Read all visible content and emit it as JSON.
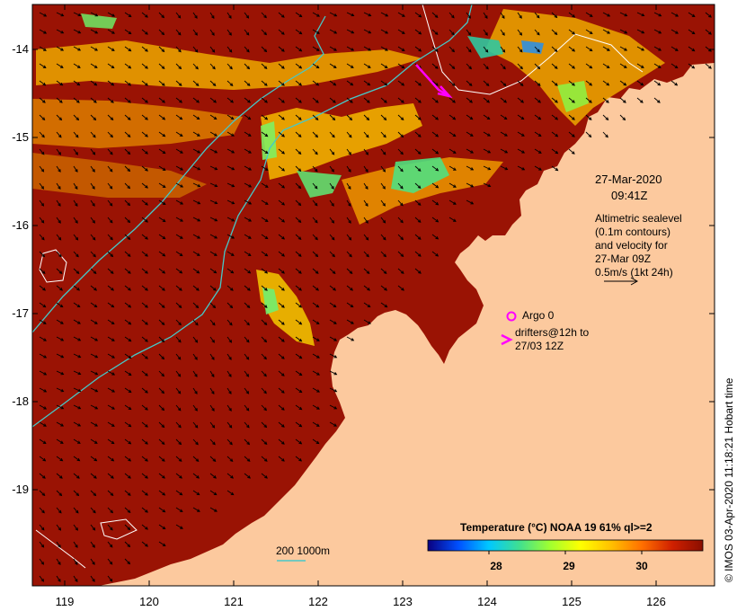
{
  "lat_axis": {
    "labels": [
      "-14",
      "-15",
      "-16",
      "-17",
      "-18",
      "-19"
    ],
    "values": [
      -14,
      -15,
      -16,
      -17,
      -18,
      -19
    ]
  },
  "lon_axis": {
    "labels": [
      "119",
      "120",
      "121",
      "122",
      "123",
      "124",
      "125",
      "126"
    ],
    "values": [
      119,
      120,
      121,
      122,
      123,
      124,
      125,
      126
    ]
  },
  "annotation": {
    "date": "27-Mar-2020",
    "time": "09:41Z",
    "sealevel_lines": [
      "Altimetric sealevel",
      "(0.1m contours)",
      "and velocity for",
      "27-Mar 09Z",
      "0.5m/s (1kt 24h)"
    ],
    "argo_label": "Argo 0",
    "drifters_lines": [
      "drifters@12h to",
      "27/03 12Z"
    ]
  },
  "bathymetry_label": "200  1000m",
  "colorbar": {
    "title": "Temperature (°C) NOAA 19 61% ql>=2",
    "ticks": [
      "28",
      "29",
      "30"
    ],
    "tick_values": [
      28,
      29,
      30
    ],
    "range": [
      27.2,
      30.8
    ],
    "colors": [
      "#0a0080",
      "#0050ff",
      "#00c8ff",
      "#40e090",
      "#a0ff30",
      "#ffff00",
      "#ffc000",
      "#ff7000",
      "#d02000",
      "#8a0e00"
    ]
  },
  "credit": "© IMOS 03-Apr-2020 11:18:21 Hobart time",
  "colors": {
    "land": "#fcc99e",
    "warm_sea": "#9a1304",
    "contour": "#46c8c8",
    "drifter": "#ff00ff"
  }
}
